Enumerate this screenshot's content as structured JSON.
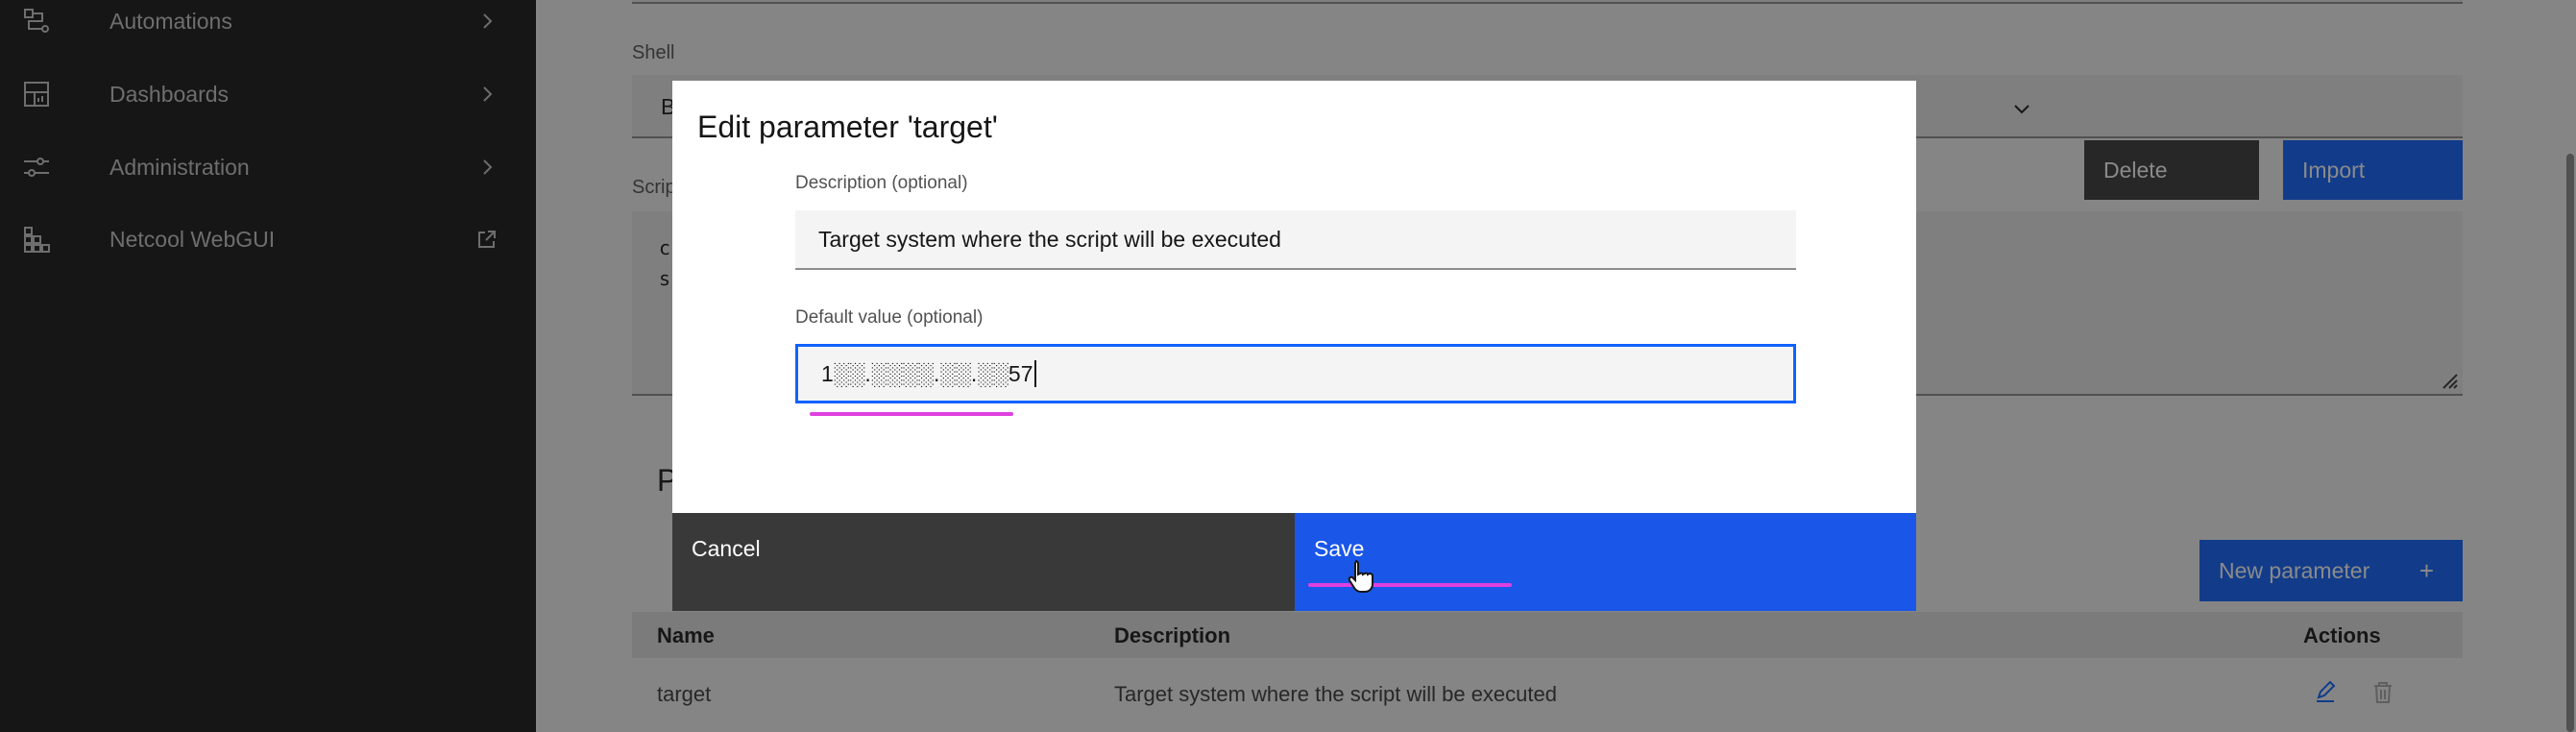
{
  "sidebar": {
    "items": [
      {
        "label": "Automations",
        "icon": "flow-icon"
      },
      {
        "label": "Dashboards",
        "icon": "dashboard-icon"
      },
      {
        "label": "Administration",
        "icon": "sliders-icon"
      },
      {
        "label": "Netcool WebGUI",
        "icon": "grid-icon"
      }
    ]
  },
  "background": {
    "shell_label": "Shell",
    "shell_value": "B",
    "script_label": "Scrip",
    "script_lines": [
      "c",
      "s"
    ],
    "delete_button": "Delete",
    "import_button": "Import",
    "section_initial": "P",
    "new_parameter_button": "New parameter",
    "new_parameter_plus": "+",
    "table": {
      "columns": [
        "Name",
        "Description",
        "Actions"
      ],
      "rows": [
        {
          "name": "target",
          "description": "Target system where the script will be executed"
        }
      ]
    }
  },
  "modal": {
    "title": "Edit parameter 'target'",
    "description_label": "Description (optional)",
    "description_value": "Target system where the script will be executed",
    "default_label": "Default value (optional)",
    "default_value": "1░░.░░░░.░░.░░57",
    "cancel_button": "Cancel",
    "save_button": "Save"
  },
  "colors": {
    "primary": "#1a56e8",
    "sidebar": "#161616",
    "annotation": "#e040e0"
  }
}
